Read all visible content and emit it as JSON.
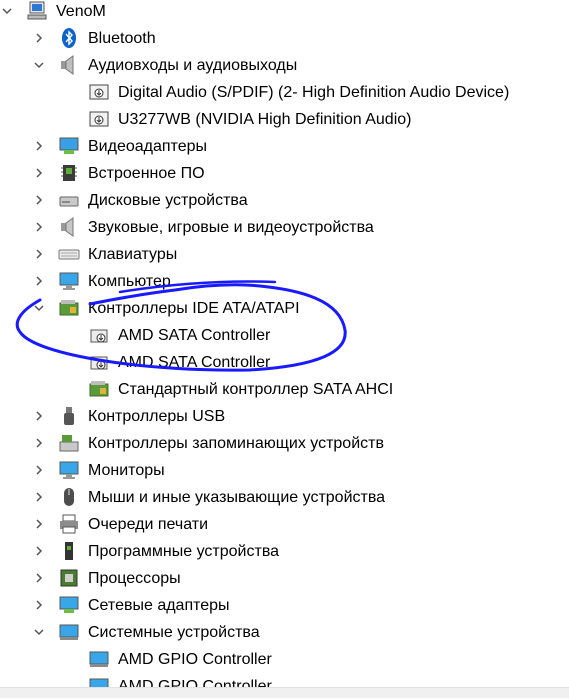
{
  "tree": [
    {
      "level": 0,
      "state": "expanded",
      "icon": "computer-icon",
      "label": "VenoM"
    },
    {
      "level": 1,
      "state": "collapsed",
      "icon": "bluetooth-icon",
      "label": "Bluetooth"
    },
    {
      "level": 1,
      "state": "expanded",
      "icon": "speaker-icon",
      "label": "Аудиовходы и аудиовыходы"
    },
    {
      "level": 2,
      "state": "leaf",
      "icon": "audio-device-icon",
      "label": "Digital Audio (S/PDIF) (2- High Definition Audio Device)"
    },
    {
      "level": 2,
      "state": "leaf",
      "icon": "audio-device-icon",
      "label": "U3277WB (NVIDIA High Definition Audio)"
    },
    {
      "level": 1,
      "state": "collapsed",
      "icon": "display-adapter-icon",
      "label": "Видеоадаптеры"
    },
    {
      "level": 1,
      "state": "collapsed",
      "icon": "firmware-icon",
      "label": "Встроенное ПО"
    },
    {
      "level": 1,
      "state": "collapsed",
      "icon": "disk-drive-icon",
      "label": "Дисковые устройства"
    },
    {
      "level": 1,
      "state": "collapsed",
      "icon": "sound-icon",
      "label": "Звуковые, игровые и видеоустройства"
    },
    {
      "level": 1,
      "state": "collapsed",
      "icon": "keyboard-icon",
      "label": "Клавиатуры"
    },
    {
      "level": 1,
      "state": "collapsed",
      "icon": "monitor-icon",
      "label": "Компьютер"
    },
    {
      "level": 1,
      "state": "expanded",
      "icon": "ide-controller-icon",
      "label": "Контроллеры IDE ATA/ATAPI"
    },
    {
      "level": 2,
      "state": "leaf",
      "icon": "controller-device-icon",
      "label": "AMD SATA Controller"
    },
    {
      "level": 2,
      "state": "leaf",
      "icon": "controller-device-icon",
      "label": "AMD SATA Controller"
    },
    {
      "level": 2,
      "state": "leaf",
      "icon": "ide-controller-icon",
      "label": "Стандартный контроллер SATA AHCI"
    },
    {
      "level": 1,
      "state": "collapsed",
      "icon": "usb-icon",
      "label": "Контроллеры USB"
    },
    {
      "level": 1,
      "state": "collapsed",
      "icon": "storage-controller-icon",
      "label": "Контроллеры запоминающих устройств"
    },
    {
      "level": 1,
      "state": "collapsed",
      "icon": "monitor-icon",
      "label": "Мониторы"
    },
    {
      "level": 1,
      "state": "collapsed",
      "icon": "mouse-icon",
      "label": "Мыши и иные указывающие устройства"
    },
    {
      "level": 1,
      "state": "collapsed",
      "icon": "printer-icon",
      "label": "Очереди печати"
    },
    {
      "level": 1,
      "state": "collapsed",
      "icon": "software-device-icon",
      "label": "Программные устройства"
    },
    {
      "level": 1,
      "state": "collapsed",
      "icon": "processor-icon",
      "label": "Процессоры"
    },
    {
      "level": 1,
      "state": "collapsed",
      "icon": "network-adapter-icon",
      "label": "Сетевые адаптеры"
    },
    {
      "level": 1,
      "state": "expanded",
      "icon": "system-device-icon",
      "label": "Системные устройства"
    },
    {
      "level": 2,
      "state": "leaf",
      "icon": "system-device-icon",
      "label": "AMD GPIO Controller"
    },
    {
      "level": 2,
      "state": "leaf",
      "icon": "system-device-icon",
      "label": "AMD GPIO Controller"
    }
  ],
  "colors": {
    "annotation": "#1a1aff",
    "chevron": "#555555"
  }
}
